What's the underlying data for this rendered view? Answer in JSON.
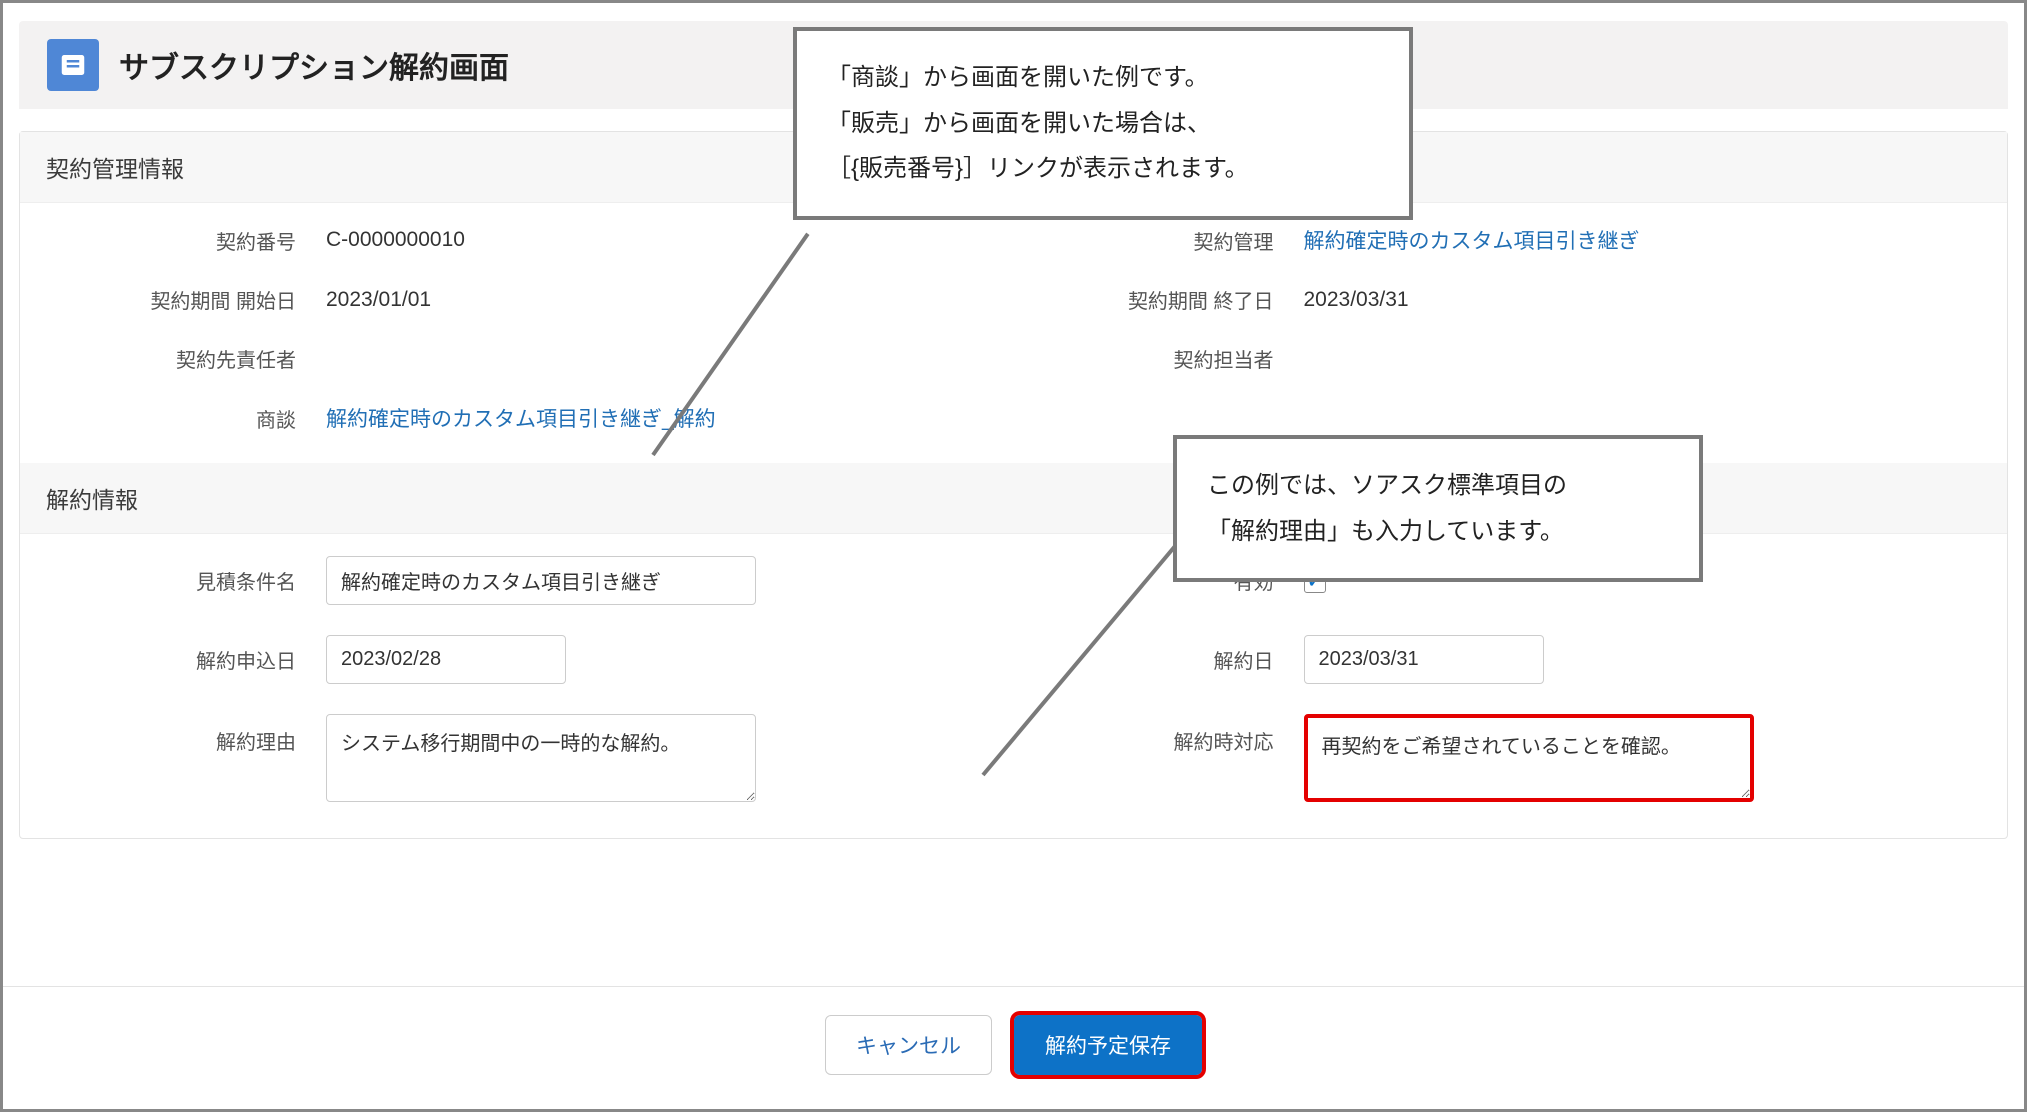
{
  "header": {
    "title": "サブスクリプション解約画面"
  },
  "sections": {
    "contract_info": {
      "heading": "契約管理情報",
      "labels": {
        "contract_no": "契約番号",
        "contract_mgmt": "契約管理",
        "period_start": "契約期間 開始日",
        "period_end": "契約期間 終了日",
        "contract_owner": "契約先責任者",
        "contract_staff": "契約担当者",
        "opportunity": "商談"
      },
      "values": {
        "contract_no": "C-0000000010",
        "contract_mgmt_link": "解約確定時のカスタム項目引き継ぎ",
        "period_start": "2023/01/01",
        "period_end": "2023/03/31",
        "contract_owner": "",
        "contract_staff": "",
        "opportunity_link": "解約確定時のカスタム項目引き継ぎ_解約"
      }
    },
    "cancel_info": {
      "heading": "解約情報",
      "labels": {
        "quote_name": "見積条件名",
        "valid": "有効",
        "apply_date": "解約申込日",
        "cancel_date": "解約日",
        "cancel_reason": "解約理由",
        "cancel_action": "解約時対応"
      },
      "values": {
        "quote_name": "解約確定時のカスタム項目引き継ぎ",
        "valid_checked": "✓",
        "apply_date": "2023/02/28",
        "cancel_date": "2023/03/31",
        "cancel_reason": "システム移行期間中の一時的な解約。",
        "cancel_action": "再契約をご希望されていることを確認。"
      }
    }
  },
  "footer": {
    "cancel_label": "キャンセル",
    "save_label": "解約予定保存"
  },
  "callouts": {
    "c1_line1": "「商談」から画面を開いた例です。",
    "c1_line2": "「販売」から画面を開いた場合は、",
    "c1_line3": "［{販売番号}］リンクが表示されます。",
    "c2_line1": "この例では、ソアスク標準項目の",
    "c2_line2": "「解約理由」も入力しています。"
  }
}
